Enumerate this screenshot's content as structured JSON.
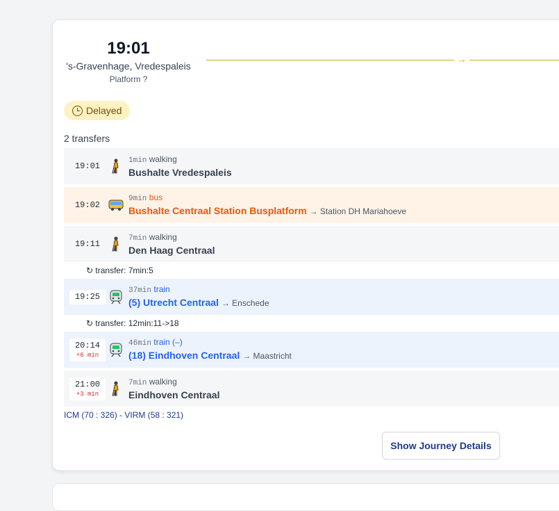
{
  "departure": {
    "time": "19:01",
    "station": "'s-Gravenhage, Vredespaleis",
    "platform": "Platform ?"
  },
  "status_badge": "Delayed",
  "transfers_count": "2 transfers",
  "legs": [
    {
      "time": "19:01",
      "delay": "",
      "duration": "1min",
      "mode": "walking",
      "name": "Bushalte Vredespaleis",
      "dest": "",
      "icon": "walking-person-icon"
    },
    {
      "time": "19:02",
      "delay": "",
      "duration": "9min",
      "mode": "bus",
      "name": "Bushalte Centraal Station Busplatform",
      "dest": "→ Station DH Mariahoeve",
      "icon": "bus-icon"
    },
    {
      "time": "19:11",
      "delay": "",
      "duration": "7min",
      "mode": "walking",
      "name": "Den Haag Centraal",
      "dest": "",
      "icon": "walking-person-icon"
    },
    {
      "time": "19:25",
      "delay": "",
      "duration": "37min",
      "mode": "train",
      "name": "(5) Utrecht Centraal",
      "dest": "→ Enschede",
      "icon": "train-icon"
    },
    {
      "time": "20:14",
      "delay": "+6 min",
      "duration": "46min",
      "mode": "train (–)",
      "name": "(18) Eindhoven Centraal",
      "dest": "→ Maastricht",
      "icon": "train-icon"
    },
    {
      "time": "21:00",
      "delay": "+3 min",
      "duration": "7min",
      "mode": "walking",
      "name": "Eindhoven Centraal",
      "dest": "",
      "icon": "walking-person-icon"
    }
  ],
  "transfers": [
    {
      "text": "↻ transfer: 7min:5"
    },
    {
      "text": "↻ transfer: 12min:11->18"
    }
  ],
  "summary": "ICM (70 : 326) - VIRM (58 : 321)",
  "button_label": "Show Journey Details",
  "colors": {
    "accent_route": "#d4a72c",
    "bus": "#ea580c",
    "train": "#2563eb",
    "delay": "#dc2626",
    "badge_bg": "#fdf2c4"
  }
}
